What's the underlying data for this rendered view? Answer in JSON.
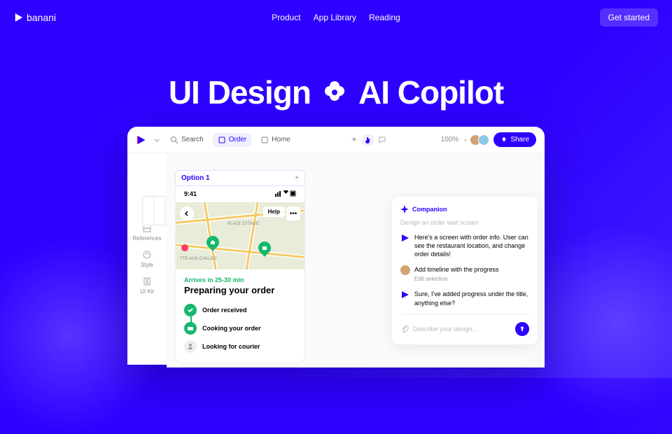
{
  "brand": "banani",
  "nav": {
    "product": "Product",
    "appLibrary": "App Library",
    "reading": "Reading"
  },
  "cta": "Get started",
  "hero": {
    "left": "UI Design",
    "right": "AI Copilot"
  },
  "toolbar": {
    "search": "Search",
    "order": "Order",
    "home": "Home",
    "zoom": "100%",
    "share": "Share"
  },
  "sidebar": {
    "references": "References",
    "style": "Style",
    "uikit": "UI Kit"
  },
  "optionTab": "Option 1",
  "phone": {
    "time": "9:41",
    "mapLabel1": "PLACE D'ITALIE",
    "mapLabel2": "TTE-AUX-CAILLES",
    "help": "Help",
    "arrives": "Arrives in 25-30 min",
    "title": "Preparing your order",
    "step1": "Order received",
    "step2": "Cooking your order",
    "step3": "Looking for courier"
  },
  "companion": {
    "title": "Companion",
    "hint": "Design an order wait screen",
    "msg1": "Here's a screen with order info. User can see the restaurant location, and change order details!",
    "msg2": "Add timeline with the progress",
    "msg2sub": "Edit selection",
    "msg3": "Sure, I've added progress under the title, anything else?",
    "placeholder": "Describe your design..."
  }
}
